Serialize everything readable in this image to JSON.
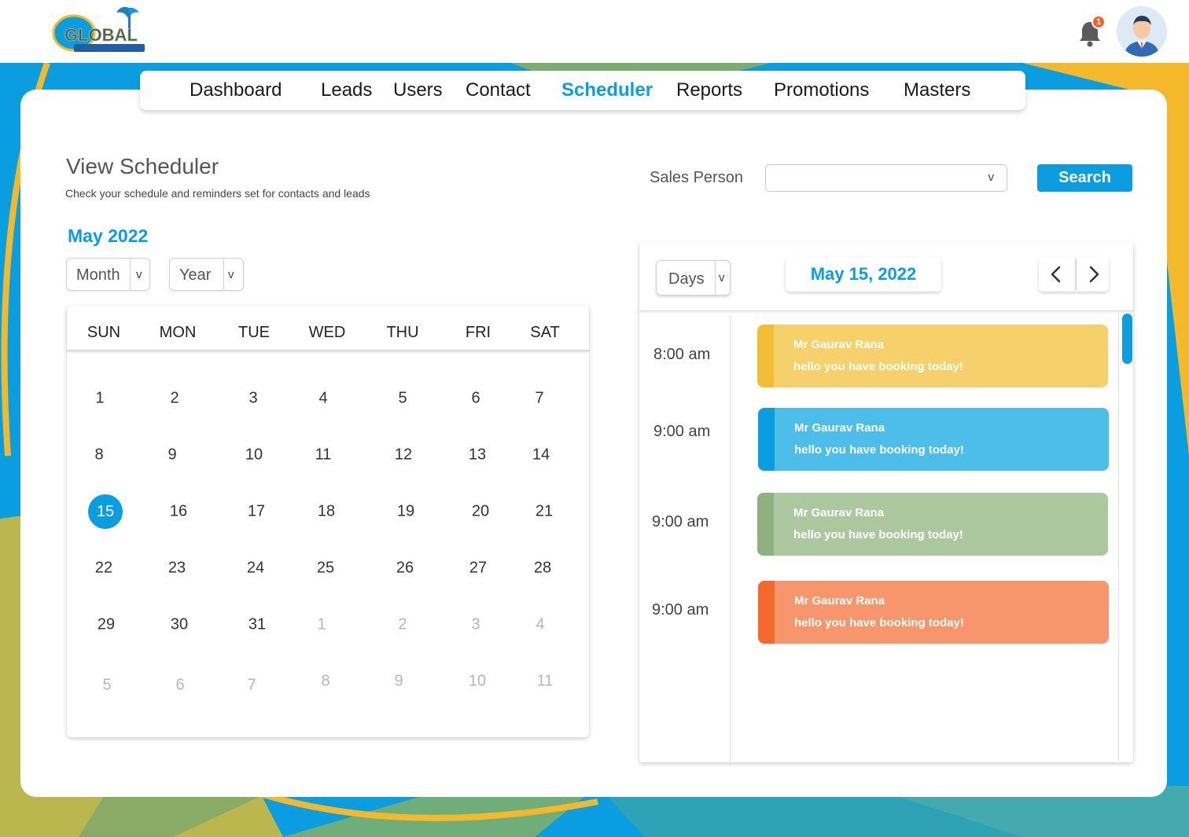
{
  "header": {
    "logo": "Global Trip Holidays Pvt Ltd",
    "notifications_count": "1"
  },
  "nav": {
    "items": [
      {
        "label": "Dashboard"
      },
      {
        "label": "Leads"
      },
      {
        "label": "Users"
      },
      {
        "label": "Contact"
      },
      {
        "label": "Scheduler"
      },
      {
        "label": "Reports"
      },
      {
        "label": "Promotions"
      },
      {
        "label": "Masters"
      }
    ],
    "active": "Scheduler"
  },
  "page": {
    "title": "View Scheduler",
    "subtitle": "Check your schedule and reminders set for contacts and leads"
  },
  "filter": {
    "sales_person_label": "Sales Person",
    "sales_person_value": "",
    "chevron": "v",
    "search_label": "Search"
  },
  "calendar": {
    "month_title": "May 2022",
    "month_select": "Month",
    "year_select": "Year",
    "chevron": "v",
    "weekdays": [
      "SUN",
      "MON",
      "TUE",
      "WED",
      "THU",
      "FRI",
      "SAT"
    ],
    "weeks": [
      [
        "1",
        "2",
        "3",
        "4",
        "5",
        "6",
        "7"
      ],
      [
        "8",
        "9",
        "10",
        "11",
        "12",
        "13",
        "14"
      ],
      [
        "15",
        "16",
        "17",
        "18",
        "19",
        "20",
        "21"
      ],
      [
        "22",
        "23",
        "24",
        "25",
        "26",
        "27",
        "28"
      ],
      [
        "29",
        "30",
        "31",
        "1",
        "2",
        "3",
        "4"
      ],
      [
        "5",
        "6",
        "7",
        "8",
        "9",
        "10",
        "11"
      ]
    ],
    "selected_day": "15"
  },
  "day_view": {
    "mode_select": "Days",
    "chevron": "v",
    "date": "May 15, 2022",
    "events": [
      {
        "time": "8:00 am",
        "name": "Mr Gaurav Rana",
        "message": "hello you have booking today!",
        "color": "#f6d06a",
        "stripe": "#f3bd36"
      },
      {
        "time": "9:00 am",
        "name": "Mr Gaurav Rana",
        "message": "hello you have booking today!",
        "color": "#4dbde9",
        "stripe": "#0a9ee0"
      },
      {
        "time": "9:00 am",
        "name": "Mr Gaurav Rana",
        "message": "hello you have booking today!",
        "color": "#acc89e",
        "stripe": "#8fb17f"
      },
      {
        "time": "9:00 am",
        "name": "Mr Gaurav Rana",
        "message": "hello you have booking today!",
        "color": "#f7966c",
        "stripe": "#f5692c"
      }
    ]
  },
  "colors": {
    "accent": "#0a9ee0",
    "badge": "#f0632a"
  }
}
